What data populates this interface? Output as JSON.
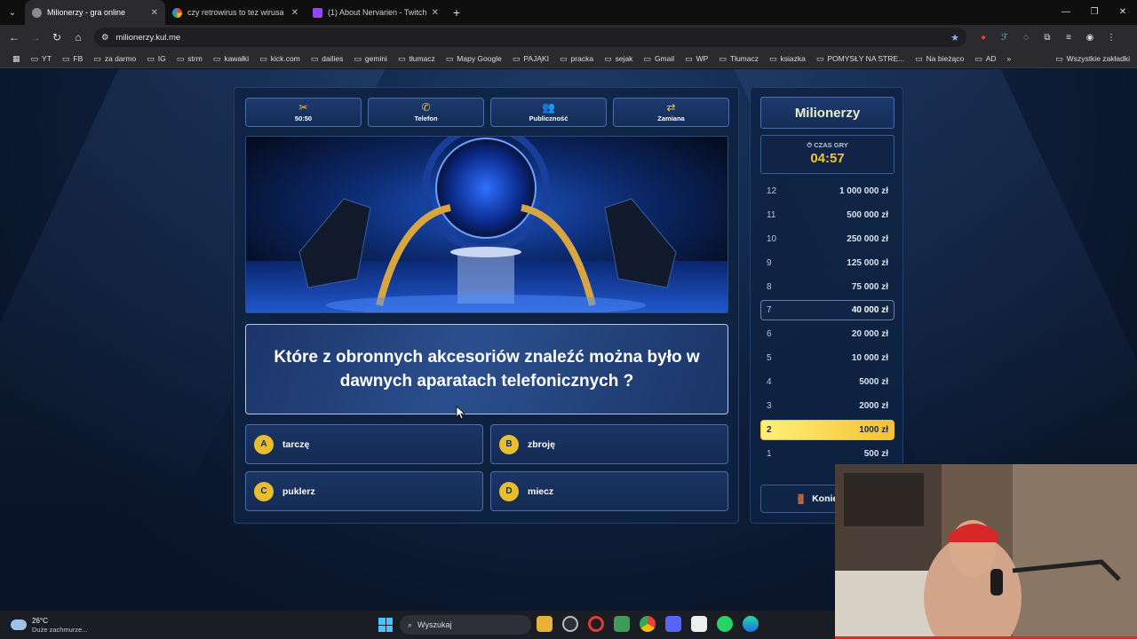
{
  "browser": {
    "tabs": [
      {
        "title": "Milionerzy - gra online",
        "active": true
      },
      {
        "title": "czy retrowirus to tez wirusa - Sz",
        "active": false
      },
      {
        "title": "(1) About Nervarien - Twitch",
        "active": false
      }
    ],
    "url": "milionerzy.kul.me",
    "bookmarks": [
      "YT",
      "FB",
      "za darmo",
      "IG",
      "strm",
      "kawałki",
      "kick.com",
      "dailies",
      "gemini",
      "tłumacz",
      "Mapy Google",
      "PAJĄKI",
      "pracka",
      "sejak",
      "Gmail",
      "WP",
      "Tłumacz",
      "ksiazka",
      "POMYSŁY NA STRE...",
      "Na bieżąco",
      "AD"
    ],
    "bookmarks_right": "Wszystkie zakładki"
  },
  "game": {
    "lifelines": [
      {
        "icon": "scissors-icon",
        "label": "50:50"
      },
      {
        "icon": "phone-icon",
        "label": "Telefon"
      },
      {
        "icon": "audience-icon",
        "label": "Publiczność"
      },
      {
        "icon": "swap-icon",
        "label": "Zamiana"
      }
    ],
    "question": "Które z obronnych akcesoriów znaleźć można było w dawnych aparatach telefonicznych ?",
    "answers": [
      {
        "letter": "A",
        "text": "tarczę"
      },
      {
        "letter": "B",
        "text": "zbroję"
      },
      {
        "letter": "C",
        "text": "puklerz"
      },
      {
        "letter": "D",
        "text": "miecz"
      }
    ]
  },
  "side": {
    "logo": "Milionerzy",
    "timer_label": "CZAS GRY",
    "timer_value": "04:57",
    "ladder": [
      {
        "n": "12",
        "amount": "1 000 000 zł",
        "state": "normal"
      },
      {
        "n": "11",
        "amount": "500 000 zł",
        "state": "normal"
      },
      {
        "n": "10",
        "amount": "250 000 zł",
        "state": "normal"
      },
      {
        "n": "9",
        "amount": "125 000 zł",
        "state": "normal"
      },
      {
        "n": "8",
        "amount": "75 000 zł",
        "state": "normal"
      },
      {
        "n": "7",
        "amount": "40 000 zł",
        "state": "milestone"
      },
      {
        "n": "6",
        "amount": "20 000 zł",
        "state": "normal"
      },
      {
        "n": "5",
        "amount": "10 000 zł",
        "state": "normal"
      },
      {
        "n": "4",
        "amount": "5000 zł",
        "state": "normal"
      },
      {
        "n": "3",
        "amount": "2000 zł",
        "state": "normal"
      },
      {
        "n": "2",
        "amount": "1000 zł",
        "state": "current"
      },
      {
        "n": "1",
        "amount": "500 zł",
        "state": "normal"
      }
    ],
    "end_label": "Konie"
  },
  "taskbar": {
    "temp": "26°C",
    "weather": "Duże zachmurze...",
    "search_placeholder": "Wyszukaj"
  },
  "colors": {
    "accent": "#f2c230",
    "panel": "#0e2242",
    "current_rung": "#f2c230"
  }
}
